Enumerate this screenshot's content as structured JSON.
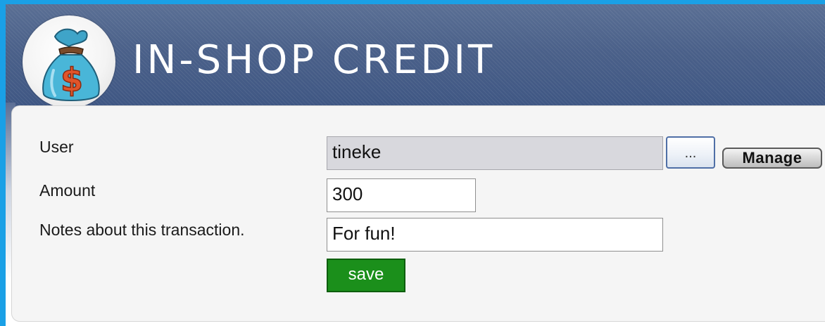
{
  "header": {
    "title": "IN-SHOP CREDIT",
    "logo_icon": "money-bag-icon"
  },
  "form": {
    "user": {
      "label": "User",
      "value": "tineke"
    },
    "amount": {
      "label": "Amount",
      "value": "300"
    },
    "notes": {
      "label": "Notes about this transaction.",
      "value": "For fun!"
    },
    "browse_label": "...",
    "manage_label": "Manage",
    "save_label": "save"
  },
  "colors": {
    "page_border": "#1aa0e6",
    "header_bg": "#4a6089",
    "save_button": "#1b8f1b"
  }
}
